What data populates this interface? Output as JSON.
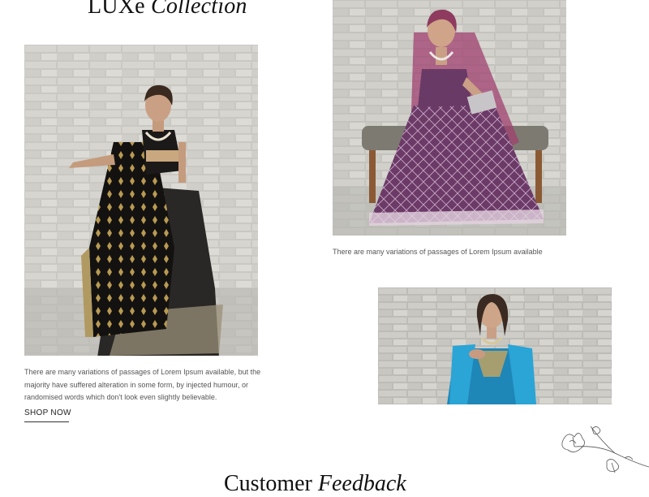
{
  "collection": {
    "title_main": "LUXe",
    "title_accent": "Collection"
  },
  "products": [
    {
      "image": "lehenga-black-gold",
      "caption": "There are many variations of passages of Lorem Ipsum available, but the majority have suffered alteration in some form, by injected humour, or randomised words which don't look even slightly believable.",
      "cta": "SHOP NOW"
    },
    {
      "image": "lehenga-purple-embroidered",
      "caption": "There are many variations of passages of Lorem Ipsum available"
    },
    {
      "image": "lehenga-turquoise"
    }
  ],
  "feedback": {
    "title_main": "Customer",
    "title_accent": "Feedback"
  },
  "decor": {
    "icon": "flower-sketch-icon"
  }
}
